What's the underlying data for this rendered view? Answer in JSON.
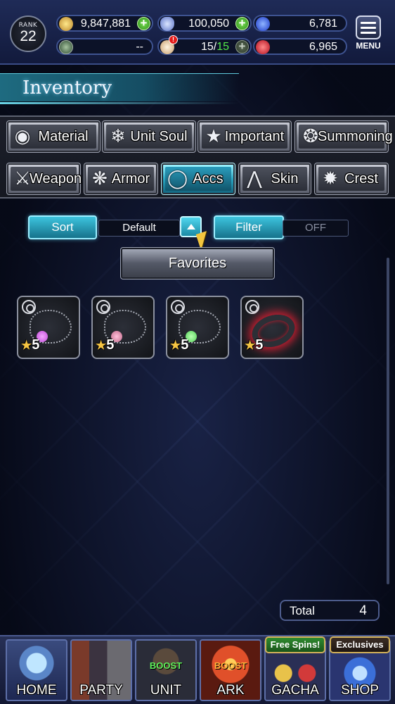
{
  "status": {
    "rank_label": "RANK",
    "rank_value": "22",
    "gold": "9,847,881",
    "crystals": "100,050",
    "blue_currency": "6,781",
    "green_slot": "--",
    "stamina_current": "15",
    "stamina_separator": "/",
    "stamina_max": "15",
    "stamina_alert": "!",
    "red_currency": "6,965",
    "plus_symbol": "+",
    "menu_label": "MENU"
  },
  "page": {
    "title": "Inventory"
  },
  "tabs_row1": [
    {
      "label": "Material",
      "icon": "material-bag-icon"
    },
    {
      "label": "Unit Soul",
      "icon": "unit-soul-icon"
    },
    {
      "label": "Important",
      "icon": "star-icon"
    },
    {
      "label": "Summoning",
      "icon": "summoning-icon"
    }
  ],
  "tabs_row2": [
    {
      "label": "Weapon",
      "icon": "sword-icon"
    },
    {
      "label": "Armor",
      "icon": "armor-icon"
    },
    {
      "label": "Accs",
      "icon": "ring-icon",
      "active": true
    },
    {
      "label": "Skin",
      "icon": "hanger-icon"
    },
    {
      "label": "Crest",
      "icon": "crest-icon"
    }
  ],
  "controls": {
    "sort_label": "Sort",
    "sort_value": "Default",
    "filter_label": "Filter",
    "filter_value": "OFF",
    "favorites_label": "Favorites"
  },
  "items": [
    {
      "type": "necklace",
      "rarity": "5",
      "gem_color": "#c04ad8"
    },
    {
      "type": "necklace",
      "rarity": "5",
      "gem_color": "#c06a8a"
    },
    {
      "type": "necklace",
      "rarity": "5",
      "gem_color": "#54d05a"
    },
    {
      "type": "ring",
      "rarity": "5",
      "gem_color": "#d11c2f"
    }
  ],
  "total": {
    "label": "Total",
    "value": "4"
  },
  "nav": [
    {
      "label": "HOME"
    },
    {
      "label": "PARTY"
    },
    {
      "label": "UNIT",
      "badge": "BOOST"
    },
    {
      "label": "ARK",
      "badge": "BOOST"
    },
    {
      "label": "GACHA",
      "tag": "Free Spins!"
    },
    {
      "label": "SHOP",
      "tag": "Exclusives"
    }
  ],
  "colors": {
    "accent": "#2aa7c4",
    "gold_star": "#f6c543",
    "boost_green": "#5ff05a"
  }
}
